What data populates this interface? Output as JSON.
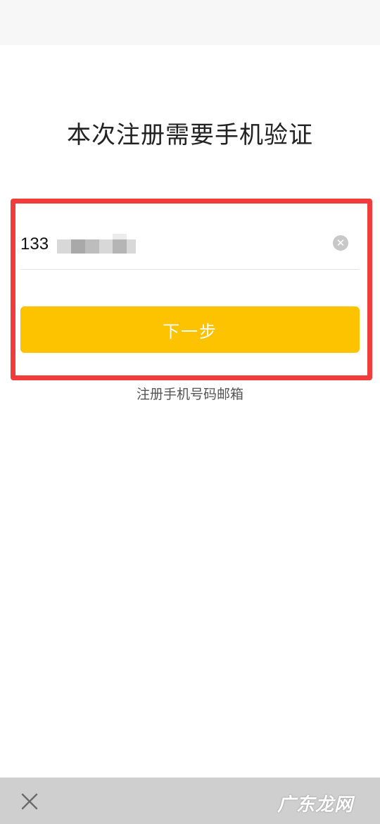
{
  "page": {
    "title": "本次注册需要手机验证"
  },
  "phone_field": {
    "value": "133"
  },
  "next_button": {
    "label": "下一步"
  },
  "switch_link": {
    "label": "注册手机号码邮箱"
  },
  "bottom_bar": {
    "watermark": "广东龙网"
  },
  "icons": {
    "clear": "clear-circle-icon",
    "close": "close-icon"
  },
  "colors": {
    "accent": "#fdc300",
    "highlight": "#f23b3b"
  }
}
